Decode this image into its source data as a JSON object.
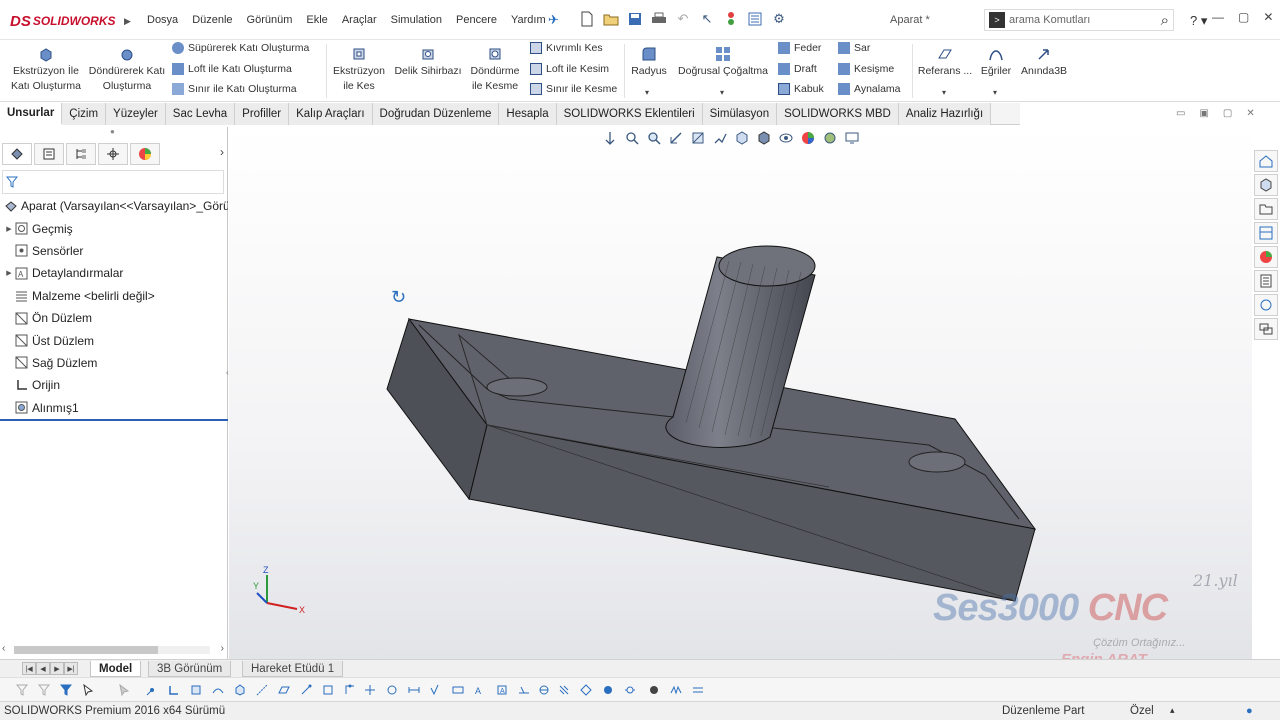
{
  "app": {
    "logo_text": "SOLIDWORKS",
    "document_title": "Aparat *"
  },
  "menu": [
    "Dosya",
    "Düzenle",
    "Görünüm",
    "Ekle",
    "Araçlar",
    "Simulation",
    "Pencere",
    "Yardım"
  ],
  "search": {
    "placeholder": "arama Komutları"
  },
  "commands": {
    "extrude_boss": "Ekstrüzyon İle Katı Oluşturma",
    "revolve_boss": "Döndürerek Katı Oluşturma",
    "sweep_boss": "Süpürerek Katı Oluşturma",
    "loft_boss": "Loft ile Katı Oluşturma",
    "boundary_boss": "Sınır ile Katı Oluşturma",
    "extrude_cut": "Ekstrüzyon ile Kes",
    "hole_wizard": "Delik Sihirbazı",
    "revolve_cut": "Döndürme ile Kesme",
    "swept_cut": "Kıvrımlı Kes",
    "loft_cut": "Loft ile Kesim",
    "boundary_cut": "Sınır ile Kesme",
    "fillet": "Radyus",
    "linear_pattern": "Doğrusal Çoğaltma",
    "rib": "Feder",
    "draft": "Draft",
    "shell": "Kabuk",
    "wrap": "Sar",
    "intersect": "Kesişme",
    "mirror": "Aynalama",
    "reference": "Referans ...",
    "curves": "Eğriler",
    "instant3d": "Anında3B"
  },
  "tabs": [
    "Unsurlar",
    "Çizim",
    "Yüzeyler",
    "Sac Levha",
    "Profiller",
    "Kalıp Araçları",
    "Doğrudan Düzenleme",
    "Hesapla",
    "SOLIDWORKS Eklentileri",
    "Simülasyon",
    "SOLIDWORKS MBD",
    "Analiz Hazırlığı"
  ],
  "active_tab": "Unsurlar",
  "feature_tree": {
    "root": "Aparat  (Varsayılan<<Varsayılan>_Görü",
    "items": [
      {
        "label": "Geçmiş",
        "icon": "history-icon",
        "expandable": true
      },
      {
        "label": "Sensörler",
        "icon": "sensor-icon",
        "expandable": false
      },
      {
        "label": "Detaylandırmalar",
        "icon": "annotations-icon",
        "expandable": true
      },
      {
        "label": "Malzeme <belirli değil>",
        "icon": "material-icon",
        "expandable": false
      },
      {
        "label": "Ön Düzlem",
        "icon": "plane-icon",
        "expandable": false
      },
      {
        "label": "Üst Düzlem",
        "icon": "plane-icon",
        "expandable": false
      },
      {
        "label": "Sağ Düzlem",
        "icon": "plane-icon",
        "expandable": false
      },
      {
        "label": "Orijin",
        "icon": "origin-icon",
        "expandable": false
      },
      {
        "label": "Alınmış1",
        "icon": "imported-body-icon",
        "expandable": false
      }
    ]
  },
  "triad": {
    "x": "X",
    "y": "Y",
    "z": "Z"
  },
  "watermark": {
    "brand": "Ses3000",
    "brand_suffix": "CNC",
    "slogan": "Çözüm Ortağınız...",
    "author": "Engin ARAT",
    "anniversary": "21.yıl"
  },
  "bottom_tabs": [
    "Model",
    "3B Görünüm",
    "Hareket Etüdü 1"
  ],
  "active_bottom_tab": "Model",
  "status": {
    "product": "SOLIDWORKS Premium 2016 x64 Sürümü",
    "mode": "Düzenleme Part",
    "units": "Özel"
  },
  "colors": {
    "brand_red": "#c8102e",
    "selection_blue": "#2b5fb5",
    "model_gray": "#5a5d66"
  }
}
